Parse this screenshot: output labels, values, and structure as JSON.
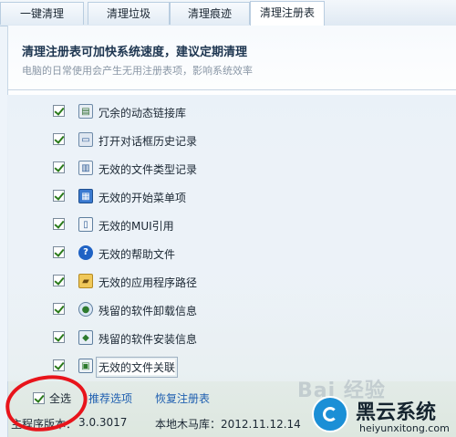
{
  "tabs": [
    {
      "label": "一键清理"
    },
    {
      "label": "清理垃圾"
    },
    {
      "label": "清理痕迹"
    },
    {
      "label": "清理注册表"
    }
  ],
  "header": {
    "title": "清理注册表可加快系统速度，建议定期清理",
    "subtitle": "电脑的日常使用会产生无用注册表项，影响系统效率"
  },
  "items": [
    {
      "label": "冗余的动态链接库",
      "icon": "dll-file-icon",
      "checked": true
    },
    {
      "label": "打开对话框历史记录",
      "icon": "dialog-history-icon",
      "checked": true
    },
    {
      "label": "无效的文件类型记录",
      "icon": "file-type-icon",
      "checked": true
    },
    {
      "label": "无效的开始菜单项",
      "icon": "start-menu-icon",
      "checked": true
    },
    {
      "label": "无效的MUI引用",
      "icon": "mui-window-icon",
      "checked": true
    },
    {
      "label": "无效的帮助文件",
      "icon": "help-icon",
      "checked": true
    },
    {
      "label": "无效的应用程序路径",
      "icon": "folder-path-icon",
      "checked": true
    },
    {
      "label": "残留的软件卸载信息",
      "icon": "uninstall-icon",
      "checked": true
    },
    {
      "label": "残留的软件安装信息",
      "icon": "install-icon",
      "checked": true
    },
    {
      "label": "无效的文件关联",
      "icon": "file-association-icon",
      "checked": true
    }
  ],
  "footer": {
    "select_all": "全选",
    "recommended": "推荐选项",
    "restore": "恢复注册表"
  },
  "status": {
    "version": "主程序版本：",
    "version_value": "3.0.3017",
    "trojan_db": "本地木马库：2012.11.12.14"
  },
  "watermark": {
    "baidu": "Bai 经验",
    "brand": "黑云系统",
    "url": "heiyunxitong.com"
  },
  "colors": {
    "annotation": "#e8141b",
    "link": "#1f5fb0",
    "check": "#2a7a1a"
  }
}
